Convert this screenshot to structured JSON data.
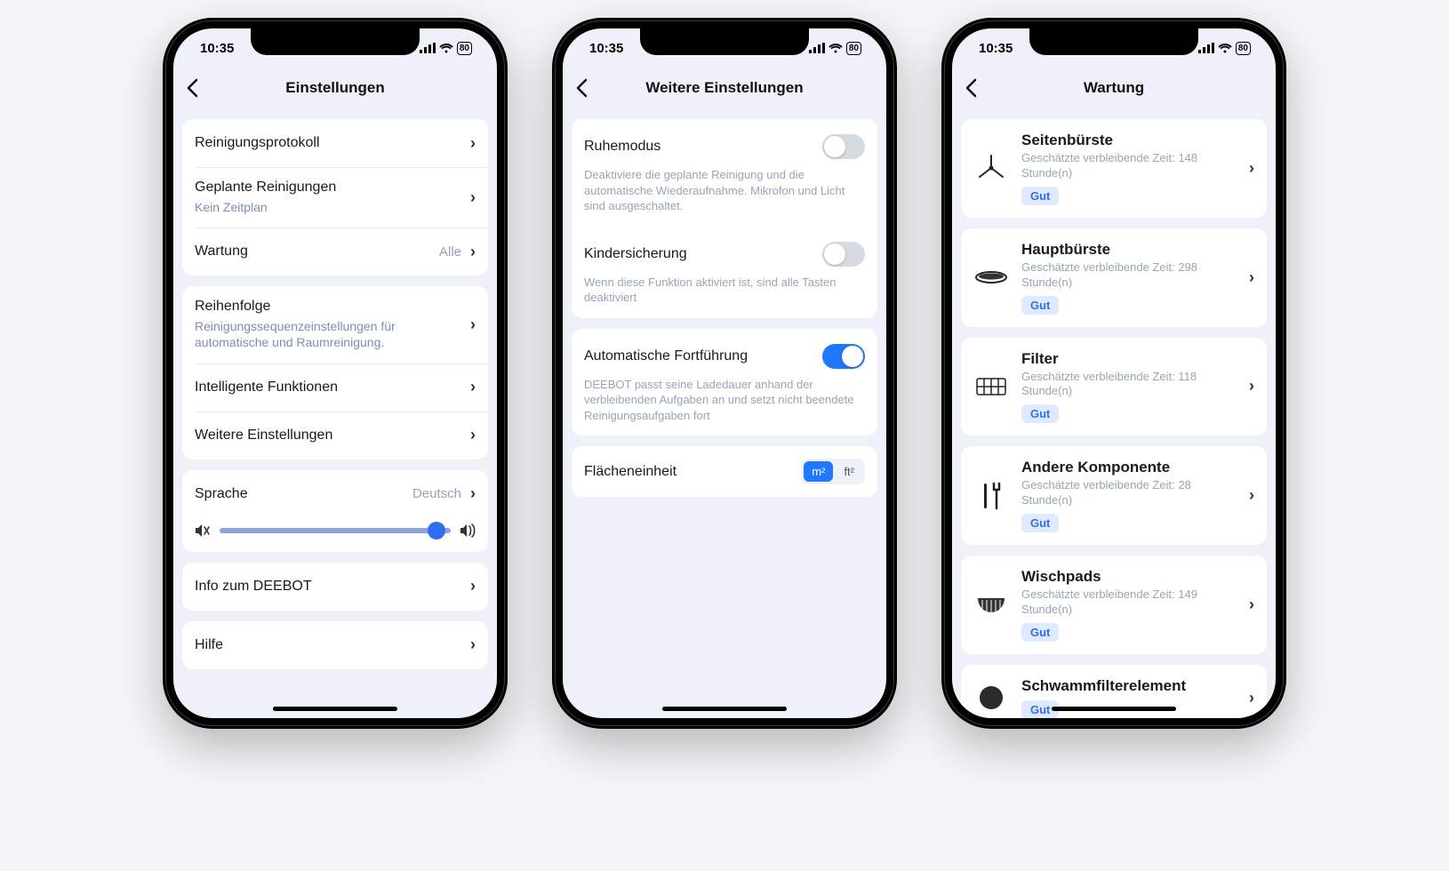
{
  "statusbar": {
    "time": "10:35",
    "battery": "80"
  },
  "phone1": {
    "title": "Einstellungen",
    "rows": {
      "log": "Reinigungsprotokoll",
      "sched_title": "Geplante Reinigungen",
      "sched_sub": "Kein Zeitplan",
      "maint_title": "Wartung",
      "maint_value": "Alle",
      "order_title": "Reihenfolge",
      "order_sub": "Reinigungssequenzeinstellungen für automatische und Raumreinigung.",
      "smart": "Intelligente Funktionen",
      "more": "Weitere Einstellungen",
      "lang_title": "Sprache",
      "lang_value": "Deutsch",
      "about": "Info zum DEEBOT",
      "help": "Hilfe"
    }
  },
  "phone2": {
    "title": "Weitere Einstellungen",
    "sleep_title": "Ruhemodus",
    "sleep_desc": "Deaktiviere die geplante Reinigung und die automatische Wiederaufnahme. Mikrofon und Licht sind ausgeschaltet.",
    "child_title": "Kindersicherung",
    "child_desc": "Wenn diese Funktion aktiviert ist, sind alle Tasten deaktiviert",
    "resume_title": "Automatische Fortführung",
    "resume_desc": "DEEBOT passt seine Ladedauer anhand der verbleibenden Aufgaben an und setzt nicht beendete Reinigungsaufgaben fort",
    "unit_title": "Flächeneinheit",
    "unit_m2": "m²",
    "unit_ft2": "ft²"
  },
  "phone3": {
    "title": "Wartung",
    "items": [
      {
        "title": "Seitenbürste",
        "sub": "Geschätzte verbleibende Zeit: 148 Stunde(n)",
        "badge": "Gut"
      },
      {
        "title": "Hauptbürste",
        "sub": "Geschätzte verbleibende Zeit: 298 Stunde(n)",
        "badge": "Gut"
      },
      {
        "title": "Filter",
        "sub": "Geschätzte verbleibende Zeit: 118 Stunde(n)",
        "badge": "Gut"
      },
      {
        "title": "Andere Komponente",
        "sub": "Geschätzte verbleibende Zeit: 28 Stunde(n)",
        "badge": "Gut"
      },
      {
        "title": "Wischpads",
        "sub": "Geschätzte verbleibende Zeit: 149 Stunde(n)",
        "badge": "Gut"
      },
      {
        "title": "Schwammfilterelement",
        "sub": "",
        "badge": "Gut"
      }
    ]
  }
}
